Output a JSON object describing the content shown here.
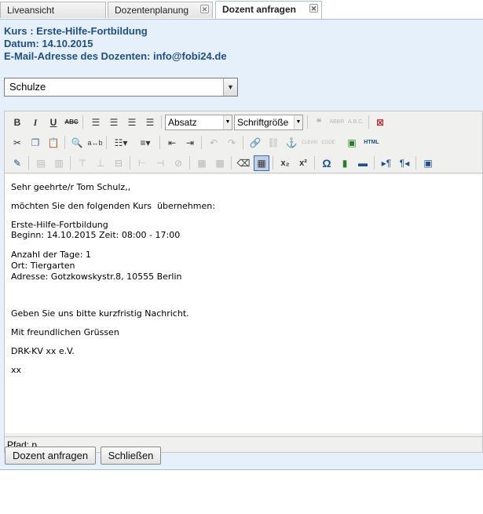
{
  "tabs": [
    {
      "label": "Liveansicht"
    },
    {
      "label": "Dozentenplanung"
    },
    {
      "label": "Dozent anfragen"
    }
  ],
  "header": {
    "course": "Kurs : Erste-Hilfe-Fortbildung",
    "date": "Datum: 14.10.2015",
    "email": "E-Mail-Adresse des Dozenten: info@fobi24.de"
  },
  "teacher_select": {
    "value": "Schulze"
  },
  "toolbar": {
    "format": "Absatz",
    "fontsize": "Schriftgröße",
    "html_label": "HTML"
  },
  "body_lines": [
    "Sehr geehrte/r Tom Schulz,,",
    "möchten Sie den folgenden Kurs  übernehmen:",
    "Erste-Hilfe-Fortbildung",
    "Beginn: 14.10.2015 Zeit: 08:00 - 17:00",
    "Anzahl der Tage: 1",
    "Ort: Tiergarten",
    "Adresse: Gotzkowskystr.8, 10555 Berlin",
    "Geben Sie uns bitte kurzfristig Nachricht.",
    "Mit freundlichen Grüssen",
    "DRK-KV xx e.V.",
    "xx"
  ],
  "status": {
    "path": "Pfad: p"
  },
  "buttons": {
    "request": "Dozent anfragen",
    "close": "Schließen"
  }
}
